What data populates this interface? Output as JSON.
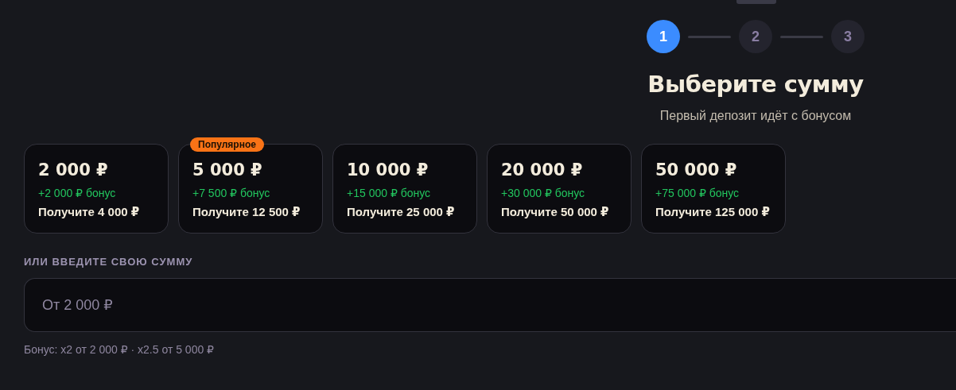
{
  "steps": [
    {
      "label": "1",
      "selected": true
    },
    {
      "label": "2",
      "selected": false
    },
    {
      "label": "3",
      "selected": false
    }
  ],
  "title": "Выберите сумму",
  "subtitle": "Первый депозит идёт с бонусом",
  "packages": [
    {
      "amount": "2 000 ₽",
      "bonus": "+2 000 ₽ бонус",
      "total": "Получите 4 000 ₽"
    },
    {
      "amount": "5 000 ₽",
      "bonus": "+7 500 ₽ бонус",
      "total": "Получите 12 500 ₽",
      "badge": "Популярное"
    },
    {
      "amount": "10 000 ₽",
      "bonus": "+15 000 ₽ бонус",
      "total": "Получите 25 000 ₽"
    },
    {
      "amount": "20 000 ₽",
      "bonus": "+30 000 ₽ бонус",
      "total": "Получите 50 000 ₽"
    },
    {
      "amount": "50 000 ₽",
      "bonus": "+75 000 ₽ бонус",
      "total": "Получите 125 000 ₽"
    }
  ],
  "custom_amount": {
    "label": "ИЛИ ВВЕДИТЕ СВОЮ СУММУ",
    "placeholder": "От 2 000 ₽",
    "hint": "Бонус: x2 от 2 000 ₽ · x2.5 от 5 000 ₽"
  }
}
